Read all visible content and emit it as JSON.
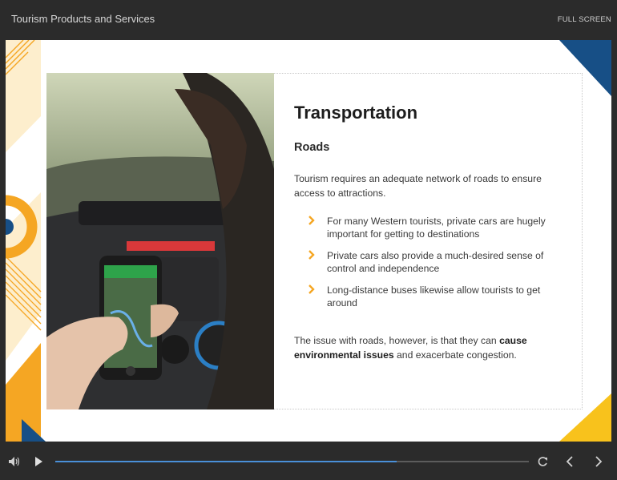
{
  "header": {
    "course_title": "Tourism Products and Services",
    "fullscreen_label": "FULL SCREEN"
  },
  "slide": {
    "title": "Transportation",
    "subtitle": "Roads",
    "intro": "Tourism requires an adequate network of roads to ensure access to attractions.",
    "bullets": [
      "For many Western tourists, private cars are hugely important for getting to destinations",
      "Private cars also provide a much-desired sense of control and independence",
      "Long-distance buses likewise allow tourists to get around"
    ],
    "closing_pre": "The issue with roads, however, is that they can ",
    "closing_bold": "cause environmental issues",
    "closing_post": " and exacerbate congestion."
  },
  "player": {
    "progress_fraction": 0.72,
    "icons": [
      "volume-icon",
      "play-icon",
      "replay-icon",
      "previous-icon",
      "next-icon"
    ]
  },
  "colors": {
    "accent_orange": "#f5a623",
    "accent_yellow": "#f8c21c",
    "accent_navy": "#174f86",
    "progress_blue": "#4a90d9"
  }
}
